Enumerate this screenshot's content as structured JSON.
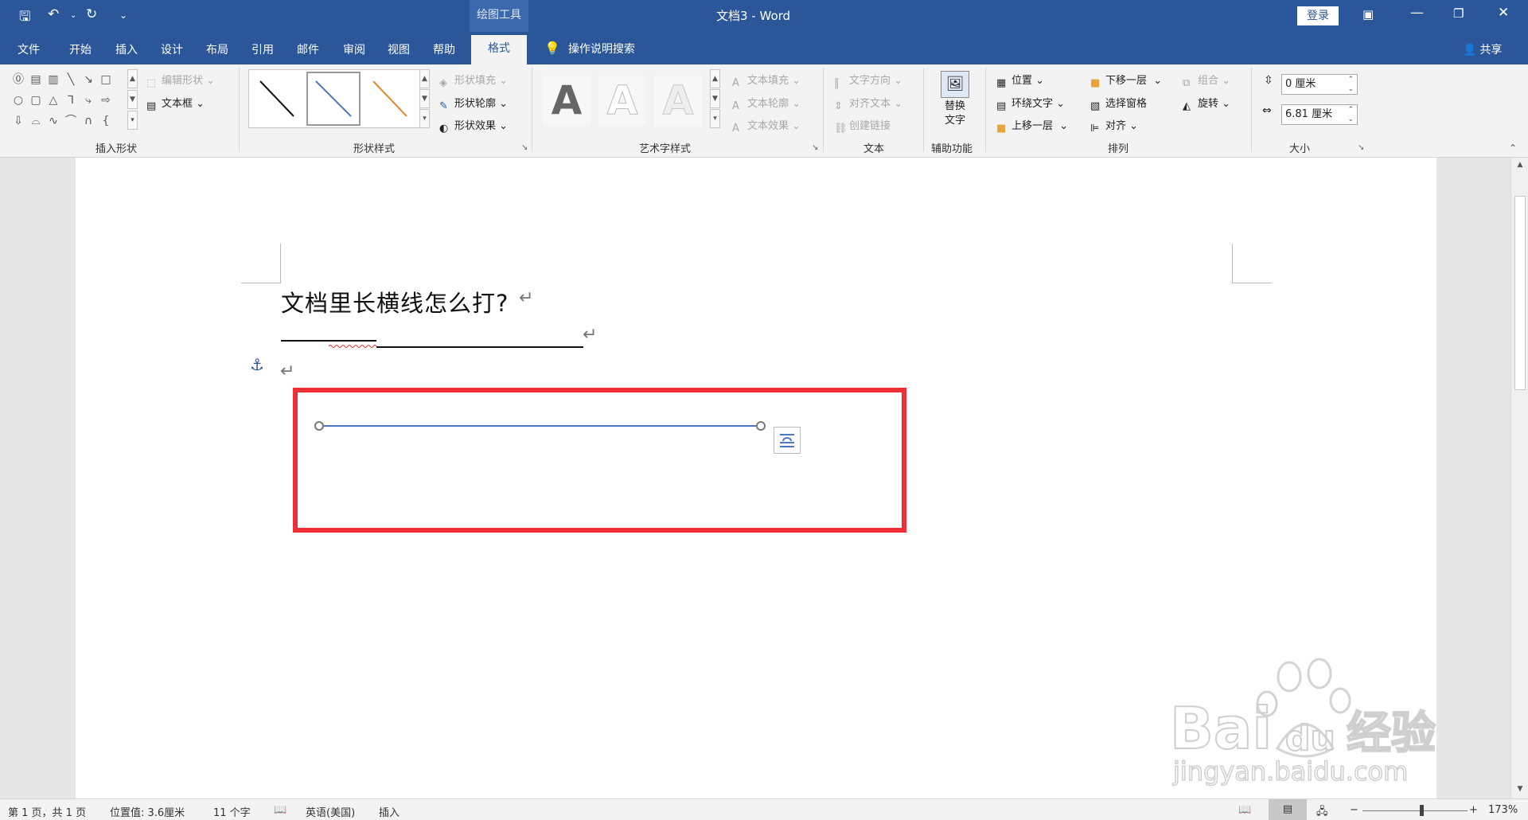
{
  "titlebar": {
    "context_tools": "绘图工具",
    "doc_title": "文档3 - Word",
    "login": "登录",
    "qa_save": "🖫",
    "qa_undo": "↶",
    "qa_redo": "↻",
    "qa_more": "⌄"
  },
  "tabs": {
    "file": "文件",
    "home": "开始",
    "insert": "插入",
    "design": "设计",
    "layout": "布局",
    "references": "引用",
    "mailings": "邮件",
    "review": "审阅",
    "view": "视图",
    "help": "帮助",
    "format": "格式",
    "search": "操作说明搜索",
    "share": "共享"
  },
  "ribbon": {
    "insert_shapes": {
      "label": "插入形状",
      "edit_shape": "编辑形状",
      "text_box": "文本框"
    },
    "shape_styles": {
      "label": "形状样式",
      "fill": "形状填充",
      "outline": "形状轮廓",
      "effects": "形状效果"
    },
    "wordart": {
      "label": "艺术字样式",
      "letter": "A",
      "text_fill": "文本填充",
      "text_outline": "文本轮廓",
      "text_effects": "文本效果"
    },
    "text": {
      "label": "文本",
      "direction": "文字方向",
      "align": "对齐文本",
      "link": "创建链接"
    },
    "accessibility": {
      "label": "辅助功能",
      "alt_line1": "替换",
      "alt_line2": "文字"
    },
    "arrange": {
      "label": "排列",
      "position": "位置",
      "wrap": "环绕文字",
      "bring_forward": "上移一层",
      "send_backward": "下移一层",
      "selection_pane": "选择窗格",
      "align": "对齐",
      "group": "组合",
      "rotate": "旋转"
    },
    "size": {
      "label": "大小",
      "height": "0 厘米",
      "width": "6.81 厘米"
    }
  },
  "document": {
    "heading": "文档里长横线怎么打?",
    "para_mark": "↵",
    "anchor": "⚓"
  },
  "statusbar": {
    "page": "第 1 页，共 1 页",
    "position": "位置值: 3.6厘米",
    "words": "11 个字",
    "language": "英语(美国)",
    "mode": "插入",
    "zoom": "173%",
    "zoom_minus": "−",
    "zoom_plus": "+"
  },
  "watermark": {
    "brand": "Bai",
    "brand2": "du",
    "brand_cn": "经验",
    "url": "jingyan.baidu.com"
  },
  "colors": {
    "word_blue": "#2b579a",
    "highlight_red": "#ee2f36",
    "line_blue": "#4a78c2"
  }
}
